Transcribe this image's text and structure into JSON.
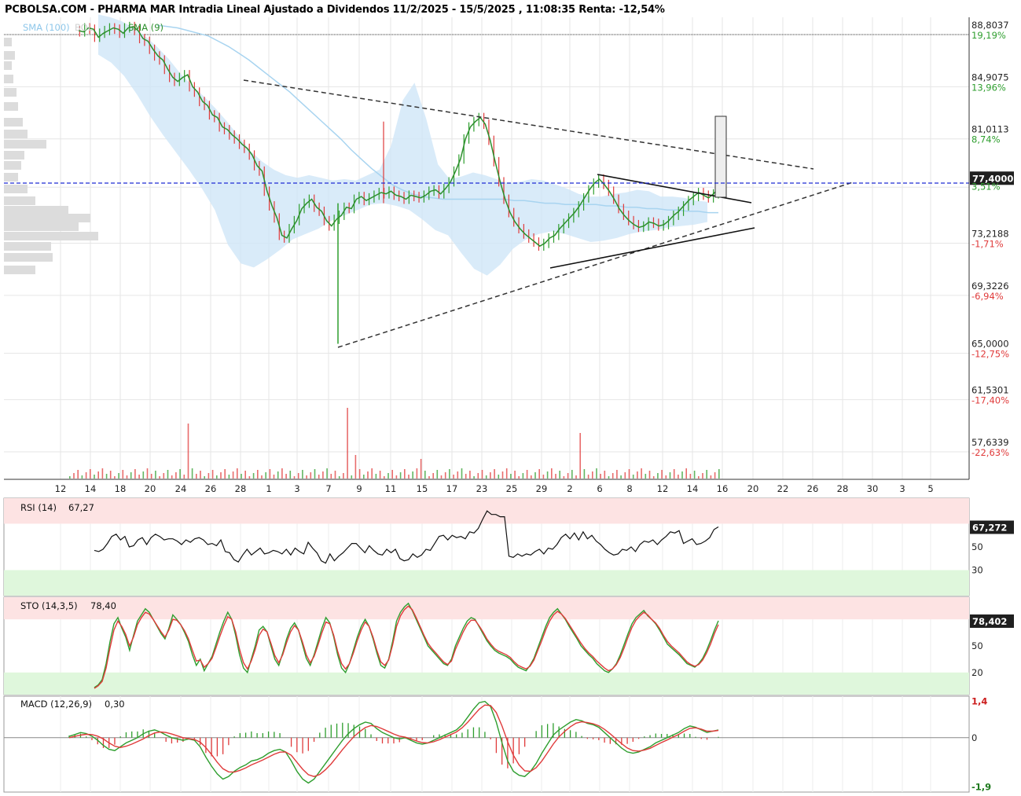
{
  "title": "PCBOLSA.COM - PHARMA MAR Intradia Lineal Ajustado a Dividendos 11/2/2025 - 15/5/2025 , 11:08:35 Renta: -12,54%",
  "colors": {
    "up": "#2e9e2e",
    "down": "#e03b3b",
    "sma100": "#a8d4f0",
    "band": "#cfe6f7",
    "sma9": "#2c8f2c",
    "trend": "#333333",
    "current": "#1f2bd4",
    "profile": "#dcdcdc"
  },
  "chart_data": [
    {
      "type": "line",
      "name": "price",
      "legend": [
        "SMA (100)",
        "BOL",
        "SMA (9)"
      ],
      "y_axis_labels": [
        "88,8037",
        "84,9075",
        "81,0113",
        "77,4000",
        "73,2188",
        "69,3226",
        "65,0000",
        "61,5301",
        "57,6339"
      ],
      "y_axis_values": [
        88.8037,
        84.9075,
        81.0113,
        77.4,
        73.2188,
        69.3226,
        65.0,
        61.5301,
        57.6339
      ],
      "pct_labels": [
        "19,19%",
        "13,96%",
        "8,74%",
        "3,51%",
        "-1,71%",
        "-6,94%",
        "-12,75%",
        "-17,40%",
        "-22,63%"
      ],
      "last_value": "77,4000",
      "x_ticks": [
        "12",
        "14",
        "18",
        "20",
        "24",
        "26",
        "28",
        "1",
        "3",
        "7",
        "9",
        "11",
        "15",
        "17",
        "23",
        "25",
        "29",
        "2",
        "6",
        "8",
        "12",
        "14",
        "16",
        "20",
        "22",
        "26",
        "28",
        "30",
        "3",
        "5"
      ],
      "close": [
        88.4,
        88.3,
        88.6,
        88.5,
        87.9,
        88.2,
        88.4,
        88.6,
        88.5,
        88.2,
        88.6,
        88.7,
        88.4,
        87.8,
        87.6,
        87.0,
        86.5,
        86.2,
        85.5,
        84.9,
        84.6,
        84.9,
        85.1,
        84.2,
        83.8,
        83.1,
        82.8,
        82.1,
        81.9,
        81.2,
        81.0,
        80.6,
        80.3,
        79.9,
        79.6,
        79.1,
        78.3,
        77.9,
        76.4,
        75.3,
        74.4,
        73.1,
        72.9,
        73.6,
        74.2,
        75.1,
        75.5,
        75.8,
        75.2,
        74.9,
        74.2,
        73.8,
        74.3,
        74.6,
        75.2,
        75.1,
        75.8,
        76.0,
        75.7,
        75.9,
        76.1,
        76.3,
        76.2,
        76.4,
        76.1,
        76.0,
        75.8,
        76.1,
        76.0,
        75.9,
        76.1,
        76.4,
        76.5,
        76.2,
        76.6,
        77.1,
        77.9,
        78.8,
        80.3,
        81.2,
        81.6,
        81.9,
        81.4,
        80.2,
        78.6,
        77.1,
        75.8,
        74.8,
        74.1,
        73.6,
        73.2,
        72.9,
        72.6,
        72.3,
        72.5,
        72.9,
        73.1,
        73.6,
        74.0,
        74.4,
        74.8,
        75.3,
        75.9,
        76.5,
        77.0,
        77.3,
        76.9,
        76.4,
        75.8,
        75.1,
        74.6,
        74.2,
        73.9,
        73.7,
        73.8,
        74.1,
        74.0,
        73.8,
        73.9,
        74.2,
        74.6,
        74.9,
        75.3,
        75.7,
        76.0,
        76.3,
        76.1,
        75.9,
        76.2,
        76.6
      ],
      "sma100": [
        88.8,
        88.7,
        88.6,
        88.4,
        88.2,
        88.0,
        87.6,
        87.2,
        86.7,
        86.2,
        85.6,
        85.0,
        84.4,
        83.8,
        83.1,
        82.4,
        81.7,
        81.0,
        80.3,
        79.5,
        78.8,
        78.1,
        77.5,
        76.9,
        76.5,
        76.2,
        76.0,
        75.9,
        75.8,
        75.8,
        75.8,
        75.8,
        75.8,
        75.8,
        75.8,
        75.7,
        75.7,
        75.6,
        75.5,
        75.5,
        75.4,
        75.4,
        75.4,
        75.4,
        75.3,
        75.3,
        75.2,
        75.2,
        75.1,
        75.1,
        75.0,
        75.0,
        74.9,
        74.9,
        74.8,
        74.8
      ],
      "bol_upper": [
        89.6,
        89.4,
        89.1,
        88.6,
        88.0,
        87.2,
        86.3,
        85.2,
        84.3,
        83.5,
        82.6,
        81.6,
        80.5,
        79.4,
        78.6,
        78.0,
        77.6,
        77.4,
        77.6,
        77.4,
        77.2,
        77.3,
        77.2,
        77.6,
        78.0,
        79.8,
        83.2,
        84.5,
        81.8,
        78.4,
        77.3,
        77.5,
        77.8,
        77.6,
        77.3,
        77.0,
        77.1,
        77.3,
        77.2,
        76.9,
        76.6,
        76.2,
        76.0,
        76.0,
        76.2,
        76.3,
        76.5,
        76.4,
        76.0,
        76.0,
        75.9,
        75.7,
        75.6
      ],
      "bol_lower": [
        86.6,
        86.0,
        85.0,
        83.6,
        82.0,
        80.6,
        79.3,
        78.0,
        76.6,
        75.0,
        72.4,
        71.0,
        70.7,
        71.3,
        72.0,
        72.8,
        73.2,
        73.6,
        74.2,
        74.6,
        75.0,
        75.4,
        75.5,
        75.3,
        75.0,
        74.3,
        73.5,
        73.1,
        71.8,
        70.6,
        70.1,
        70.9,
        72.1,
        72.8,
        73.2,
        73.4,
        73.2,
        72.9,
        72.6,
        72.7,
        72.9,
        73.2,
        73.4,
        73.5,
        73.7,
        73.8,
        73.9,
        74.1
      ]
    },
    {
      "type": "line",
      "name": "RSI (14)",
      "label": "RSI (14)",
      "last": "67,27",
      "last_box": "67,272",
      "levels": [
        "70",
        "50",
        "30"
      ],
      "y_axis_labels": [
        "50",
        "30"
      ],
      "ylim": [
        0,
        100
      ],
      "values": [
        47,
        46,
        48,
        53,
        59,
        61,
        56,
        59,
        50,
        51,
        56,
        58,
        52,
        58,
        61,
        59,
        56,
        57,
        57,
        55,
        52,
        56,
        54,
        57,
        58,
        56,
        52,
        53,
        51,
        56,
        46,
        45,
        39,
        37,
        43,
        48,
        43,
        46,
        49,
        44,
        45,
        47,
        46,
        44,
        48,
        43,
        49,
        46,
        44,
        54,
        49,
        45,
        38,
        36,
        44,
        38,
        42,
        45,
        49,
        53,
        53,
        49,
        45,
        51,
        47,
        44,
        43,
        48,
        45,
        48,
        40,
        38,
        39,
        44,
        41,
        43,
        48,
        47,
        53,
        59,
        60,
        56,
        60,
        58,
        59,
        57,
        63,
        62,
        66,
        74,
        81,
        78,
        78,
        76,
        76,
        42,
        41,
        44,
        42,
        44,
        43,
        46,
        48,
        44,
        49,
        48,
        52,
        58,
        61,
        57,
        62,
        56,
        63,
        57,
        60,
        55,
        52,
        48,
        45,
        43,
        44,
        48,
        47,
        50,
        46,
        52,
        55,
        54,
        56,
        52,
        56,
        59,
        63,
        62,
        64,
        53,
        55,
        57,
        52,
        53,
        55,
        58,
        65,
        67.27
      ]
    },
    {
      "type": "line",
      "name": "STO (14,3,5)",
      "label": "STO (14,3,5)",
      "last": "78,40",
      "last_box": "78,402",
      "levels": [
        "80",
        "50",
        "20"
      ],
      "y_axis_labels": [
        "50",
        "20"
      ],
      "ylim": [
        0,
        100
      ],
      "k": [
        3,
        6,
        12,
        30,
        55,
        75,
        82,
        70,
        60,
        45,
        62,
        78,
        85,
        92,
        88,
        80,
        72,
        64,
        58,
        70,
        85,
        80,
        74,
        65,
        55,
        40,
        28,
        35,
        22,
        30,
        38,
        52,
        66,
        78,
        88,
        80,
        62,
        40,
        25,
        20,
        35,
        50,
        68,
        72,
        66,
        50,
        35,
        28,
        42,
        58,
        70,
        76,
        68,
        52,
        36,
        28,
        40,
        55,
        70,
        82,
        76,
        60,
        40,
        25,
        20,
        30,
        45,
        60,
        72,
        80,
        72,
        58,
        42,
        28,
        25,
        35,
        55,
        78,
        88,
        94,
        98,
        90,
        80,
        70,
        60,
        50,
        45,
        40,
        35,
        30,
        28,
        35,
        50,
        60,
        70,
        78,
        82,
        80,
        72,
        64,
        56,
        50,
        45,
        42,
        40,
        38,
        35,
        30,
        26,
        24,
        22,
        28,
        36,
        48,
        60,
        72,
        82,
        88,
        92,
        86,
        80,
        72,
        65,
        58,
        50,
        45,
        40,
        36,
        30,
        26,
        22,
        20,
        24,
        30,
        40,
        52,
        64,
        75,
        82,
        86,
        90,
        84,
        80,
        75,
        68,
        60,
        52,
        48,
        44,
        40,
        35,
        30,
        28,
        26,
        30,
        36,
        45,
        56,
        68,
        78.4
      ],
      "d": [
        2,
        5,
        10,
        25,
        48,
        68,
        78,
        72,
        63,
        50,
        60,
        74,
        82,
        88,
        86,
        80,
        73,
        66,
        60,
        68,
        80,
        79,
        74,
        67,
        58,
        45,
        33,
        34,
        26,
        30,
        36,
        48,
        61,
        73,
        83,
        80,
        66,
        46,
        31,
        24,
        33,
        46,
        62,
        69,
        66,
        53,
        39,
        31,
        40,
        54,
        66,
        73,
        68,
        55,
        40,
        31,
        38,
        51,
        65,
        77,
        75,
        62,
        44,
        30,
        24,
        30,
        42,
        56,
        68,
        77,
        72,
        60,
        45,
        32,
        28,
        34,
        51,
        72,
        84,
        91,
        95,
        91,
        82,
        72,
        62,
        53,
        47,
        42,
        37,
        32,
        29,
        33,
        46,
        56,
        66,
        74,
        79,
        79,
        73,
        66,
        58,
        52,
        47,
        44,
        42,
        40,
        37,
        32,
        28,
        26,
        24,
        27,
        34,
        45,
        56,
        68,
        78,
        85,
        89,
        86,
        81,
        74,
        67,
        60,
        53,
        47,
        42,
        38,
        33,
        29,
        25,
        22,
        24,
        29,
        37,
        48,
        60,
        71,
        79,
        84,
        88,
        85,
        80,
        76,
        70,
        62,
        55,
        50,
        46,
        42,
        37,
        32,
        29,
        27,
        29,
        34,
        42,
        52,
        64,
        74
      ]
    },
    {
      "type": "line",
      "name": "MACD (12,26,9)",
      "label": "MACD (12,26,9)",
      "last": "0,30",
      "y_axis_labels": [
        "1,4",
        "0",
        "-1,9"
      ],
      "ylim": [
        -1.9,
        1.4
      ],
      "macd": [
        0.05,
        0.12,
        0.2,
        0.16,
        0.06,
        -0.1,
        -0.3,
        -0.45,
        -0.5,
        -0.35,
        -0.2,
        -0.1,
        0.0,
        0.15,
        0.25,
        0.3,
        0.22,
        0.1,
        0.0,
        -0.05,
        -0.1,
        -0.05,
        -0.1,
        -0.35,
        -0.75,
        -1.1,
        -1.4,
        -1.6,
        -1.5,
        -1.3,
        -1.15,
        -1.05,
        -0.9,
        -0.85,
        -0.75,
        -0.6,
        -0.5,
        -0.45,
        -0.55,
        -0.9,
        -1.3,
        -1.6,
        -1.75,
        -1.6,
        -1.3,
        -1.0,
        -0.7,
        -0.4,
        -0.1,
        0.15,
        0.35,
        0.5,
        0.6,
        0.55,
        0.35,
        0.2,
        0.1,
        0.0,
        -0.05,
        0.0,
        -0.1,
        -0.2,
        -0.25,
        -0.2,
        -0.1,
        0.0,
        0.1,
        0.2,
        0.3,
        0.5,
        0.8,
        1.1,
        1.35,
        1.4,
        1.2,
        0.6,
        -0.2,
        -0.9,
        -1.3,
        -1.45,
        -1.5,
        -1.3,
        -1.0,
        -0.6,
        -0.25,
        0.1,
        0.3,
        0.45,
        0.6,
        0.7,
        0.65,
        0.55,
        0.5,
        0.4,
        0.2,
        0.0,
        -0.2,
        -0.4,
        -0.55,
        -0.6,
        -0.55,
        -0.45,
        -0.35,
        -0.2,
        -0.1,
        0.0,
        0.1,
        0.2,
        0.35,
        0.45,
        0.4,
        0.3,
        0.2,
        0.25,
        0.3
      ],
      "signal": [
        0.0,
        0.05,
        0.1,
        0.13,
        0.12,
        0.06,
        -0.05,
        -0.2,
        -0.33,
        -0.38,
        -0.33,
        -0.25,
        -0.15,
        -0.05,
        0.08,
        0.18,
        0.22,
        0.2,
        0.14,
        0.07,
        0.0,
        -0.04,
        -0.07,
        -0.17,
        -0.38,
        -0.65,
        -0.95,
        -1.2,
        -1.32,
        -1.33,
        -1.26,
        -1.17,
        -1.05,
        -0.96,
        -0.86,
        -0.75,
        -0.64,
        -0.56,
        -0.55,
        -0.68,
        -0.95,
        -1.22,
        -1.43,
        -1.5,
        -1.42,
        -1.24,
        -1.01,
        -0.74,
        -0.46,
        -0.2,
        0.04,
        0.23,
        0.39,
        0.47,
        0.43,
        0.34,
        0.24,
        0.14,
        0.06,
        0.02,
        -0.05,
        -0.13,
        -0.19,
        -0.2,
        -0.16,
        -0.08,
        0.02,
        0.12,
        0.22,
        0.38,
        0.6,
        0.85,
        1.1,
        1.26,
        1.24,
        0.97,
        0.45,
        -0.16,
        -0.68,
        -1.05,
        -1.28,
        -1.3,
        -1.16,
        -0.9,
        -0.58,
        -0.25,
        0.03,
        0.24,
        0.42,
        0.56,
        0.61,
        0.58,
        0.54,
        0.46,
        0.32,
        0.15,
        -0.04,
        -0.23,
        -0.4,
        -0.5,
        -0.52,
        -0.48,
        -0.41,
        -0.3,
        -0.19,
        -0.09,
        0.02,
        0.12,
        0.25,
        0.36,
        0.38,
        0.33,
        0.25,
        0.25,
        0.28
      ]
    }
  ]
}
